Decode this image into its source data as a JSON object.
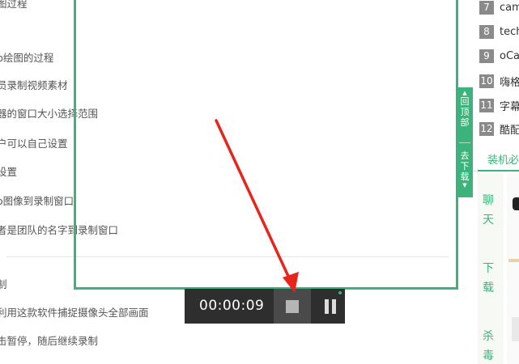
{
  "article": {
    "lines": [
      "图过程",
      "p绘图的过程",
      "员录制视频素材",
      "器的窗口大小选择范围",
      "户可以自己设置",
      "设置",
      "o图像到录制窗口",
      "者是团队的名字到录制窗口",
      "制",
      "利用这款软件捕捉摄像头全部画面",
      "击暂停，随后继续录制"
    ]
  },
  "recorder": {
    "time": "00:00:09",
    "frame_color": "#3cb37a",
    "stop_icon": "stop-icon",
    "pause_icon": "pause-icon"
  },
  "side_tab": {
    "top_label_1": "回",
    "top_label_2": "顶",
    "top_label_3": "部",
    "bottom_label_1": "去",
    "bottom_label_2": "下",
    "bottom_label_3": "载",
    "up_arrow": "▲",
    "down_arrow": "▼"
  },
  "ranking": [
    {
      "num": "7",
      "text": "cam"
    },
    {
      "num": "8",
      "text": "tech"
    },
    {
      "num": "9",
      "text": "oCa"
    },
    {
      "num": "10",
      "text": "嗨格"
    },
    {
      "num": "11",
      "text": "字幕"
    },
    {
      "num": "12",
      "text": "酷配"
    }
  ],
  "section": {
    "title": "装机必",
    "categories": [
      {
        "c1": "聊",
        "c2": "天"
      },
      {
        "c1": "下",
        "c2": "载"
      },
      {
        "c1": "杀",
        "c2": "毒"
      }
    ]
  },
  "colors": {
    "accent": "#3cb37a",
    "arrow": "#e8241c",
    "bar_bg": "#2e2e2e"
  }
}
